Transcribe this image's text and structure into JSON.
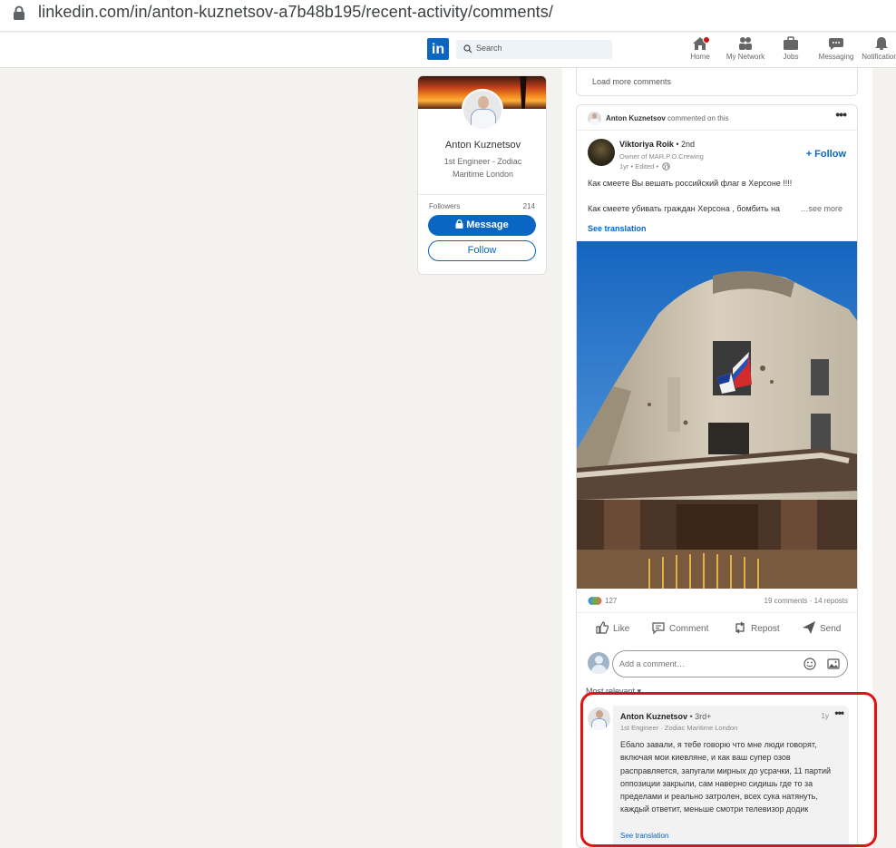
{
  "browser": {
    "url": "linkedin.com/in/anton-kuznetsov-a7b48b195/recent-activity/comments/"
  },
  "nav": {
    "logo": "in",
    "search_placeholder": "Search",
    "items": [
      {
        "label": "Home",
        "icon": "home-icon"
      },
      {
        "label": "My Network",
        "icon": "network-icon"
      },
      {
        "label": "Jobs",
        "icon": "jobs-icon"
      },
      {
        "label": "Messaging",
        "icon": "messaging-icon"
      },
      {
        "label": "Notifications",
        "icon": "bell-icon"
      }
    ]
  },
  "profile": {
    "name": "Anton Kuznetsov",
    "title": "1st Engineer - Zodiac Maritime London",
    "followers_label": "Followers",
    "followers_count": "214",
    "message_button": "Message",
    "follow_button": "Follow"
  },
  "top_card": {
    "load_more": "Load more comments"
  },
  "post": {
    "header_name": "Anton Kuznetsov",
    "header_action": "commented on this",
    "author": "Viktoriya Roik",
    "degree": "• 2nd",
    "author_subtitle": "Owner of MAR.P.O.Crewing",
    "time": "1yr • Edited •",
    "follow": "+ Follow",
    "text_line1": "Как смеете Вы вешать российский флаг в Херсоне !!!!",
    "text_line2": "Как смеете убивать граждан Херсона , бомбить на",
    "see_more": "…see more",
    "see_translation": "See translation",
    "reactions_count": "127",
    "comments_reposts": "19 comments · 14 reposts",
    "actions": {
      "like": "Like",
      "comment": "Comment",
      "repost": "Repost",
      "send": "Send"
    },
    "add_comment_placeholder": "Add a comment…",
    "sort_label": "Most relevant ▾"
  },
  "comment": {
    "name": "Anton Kuznetsov",
    "degree": "• 3rd+",
    "subtitle": "1st Engineer · Zodiac Maritime London",
    "time": "1y",
    "text": "Ебало завали, я тебе говорю что мне люди говорят, включая мои киевляне, и как ваш супер озов расправляется, запугали мирных до усрачки, 11 партий оппозиции закрыли, сам наверно сидишь где то за пределами и реально затролен, всех сука натянуть, каждый ответит, меньше смотри телевизор додик",
    "see_translation": "See translation"
  },
  "colors": {
    "accent": "#0a66c2",
    "highlight": "#e01313",
    "page_bg": "#f3f2ef"
  }
}
